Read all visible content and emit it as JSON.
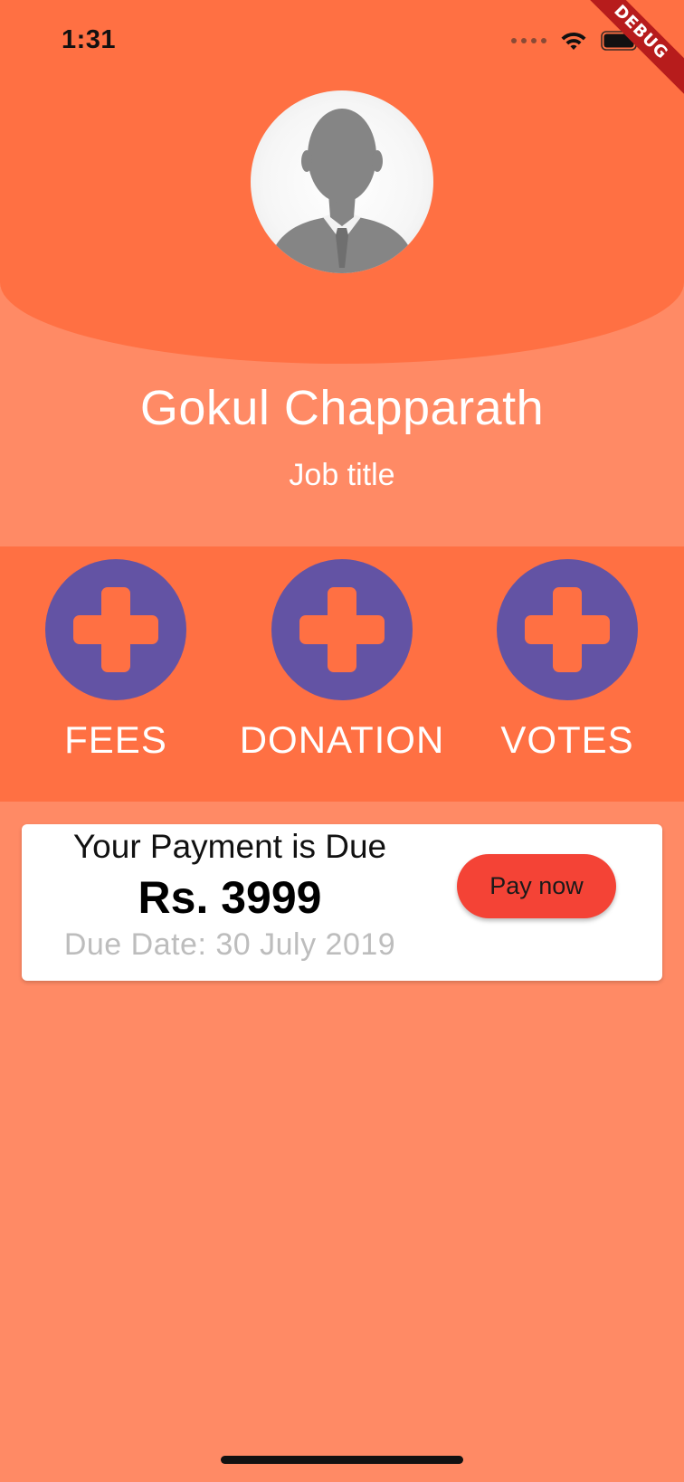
{
  "status_bar": {
    "time": "1:31",
    "icons": [
      "signal-icon",
      "wifi-icon",
      "battery-icon"
    ]
  },
  "debug_banner": "DEBUG",
  "profile": {
    "avatar_icon": "person-silhouette-icon",
    "name": "Gokul Chapparath",
    "job_title": "Job title"
  },
  "actions": [
    {
      "label": "FEES",
      "icon": "plus-icon"
    },
    {
      "label": "DONATION",
      "icon": "plus-icon"
    },
    {
      "label": "VOTES",
      "icon": "plus-icon"
    }
  ],
  "payment": {
    "heading": "Your Payment is Due",
    "amount": "Rs. 3999",
    "due_date": "Due Date: 30 July 2019",
    "button_label": "Pay now"
  },
  "colors": {
    "background": "#FF8A65",
    "header": "#FF7043",
    "action_circle": "#6353A4",
    "pay_button": "#F44336"
  }
}
